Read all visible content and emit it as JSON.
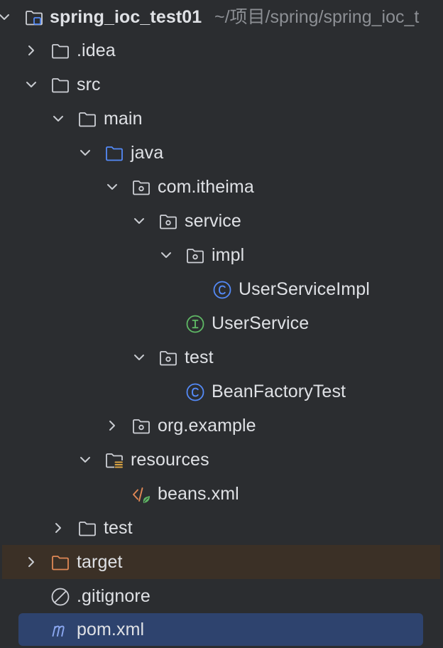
{
  "project": {
    "name": "spring_ioc_test01",
    "path": "~/项目/spring/spring_ioc_t"
  },
  "tree": [
    {
      "label": ".idea",
      "icon": "folder-icon",
      "state": "collapsed"
    },
    {
      "label": "src",
      "icon": "folder-icon",
      "state": "expanded"
    },
    {
      "label": "main",
      "icon": "folder-icon",
      "state": "expanded"
    },
    {
      "label": "java",
      "icon": "source-folder-icon",
      "state": "expanded"
    },
    {
      "label": "com.itheima",
      "icon": "package-icon",
      "state": "expanded"
    },
    {
      "label": "service",
      "icon": "package-icon",
      "state": "expanded"
    },
    {
      "label": "impl",
      "icon": "package-icon",
      "state": "expanded"
    },
    {
      "label": "UserServiceImpl",
      "icon": "java-class-icon",
      "state": "leaf"
    },
    {
      "label": "UserService",
      "icon": "java-interface-icon",
      "state": "leaf"
    },
    {
      "label": "test",
      "icon": "package-icon",
      "state": "expanded"
    },
    {
      "label": "BeanFactoryTest",
      "icon": "java-class-icon",
      "state": "leaf"
    },
    {
      "label": "org.example",
      "icon": "package-icon",
      "state": "collapsed"
    },
    {
      "label": "resources",
      "icon": "resources-folder-icon",
      "state": "expanded"
    },
    {
      "label": "beans.xml",
      "icon": "xml-file-icon",
      "state": "leaf"
    },
    {
      "label": "test",
      "icon": "folder-icon",
      "state": "collapsed"
    },
    {
      "label": "target",
      "icon": "excluded-folder-icon",
      "state": "collapsed"
    },
    {
      "label": ".gitignore",
      "icon": "ignore-file-icon",
      "state": "leaf"
    },
    {
      "label": "pom.xml",
      "icon": "maven-icon",
      "state": "leaf",
      "selected": true
    }
  ],
  "colors": {
    "background": "#2b2d30",
    "text": "#dfe1e5",
    "path_hint": "#8c8f94",
    "selection": "#2e436e",
    "excluded_row": "#3b3026",
    "class_icon": "#548af7",
    "interface_icon": "#5fb865",
    "excluded_folder": "#e08855"
  }
}
